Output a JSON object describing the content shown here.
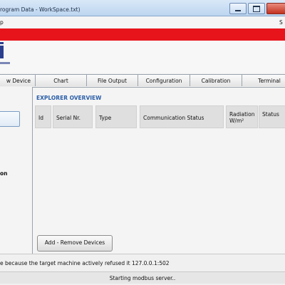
{
  "window": {
    "title": "rogram Data - WorkSpace.txt)"
  },
  "menu": {
    "help": "p",
    "right": "S"
  },
  "tabs": [
    {
      "label": "w Device"
    },
    {
      "label": "Chart"
    },
    {
      "label": "File Output"
    },
    {
      "label": "Configuration"
    },
    {
      "label": "Calibration"
    },
    {
      "label": "Terminal"
    }
  ],
  "left_panel": {
    "label": "on"
  },
  "explorer": {
    "title": "EXPLORER OVERVIEW",
    "columns": [
      "Id",
      "Serial Nr.",
      "Type",
      "Communication Status",
      "Radiation",
      "W/m²",
      "Status"
    ],
    "add_button": "Add - Remove Devices"
  },
  "status": {
    "message": "e because the target machine actively refused it 127.0.0.1:502",
    "bottom": "Starting modbus server.."
  },
  "colors": {
    "brand_red": "#e8141b",
    "logo_blue": "#2b3f8f",
    "accent_blue": "#2a5ea8"
  },
  "icons": {
    "minimize": "minimize-icon",
    "maximize": "maximize-icon",
    "close": "close-icon"
  }
}
